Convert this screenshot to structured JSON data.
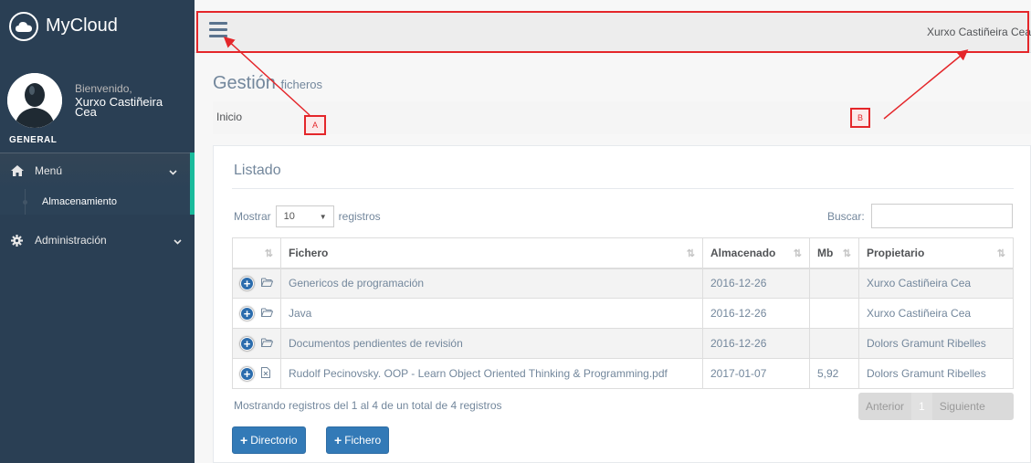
{
  "brand": {
    "title": "MyCloud"
  },
  "profile": {
    "welcome": "Bienvenido,",
    "name": "Xurxo Castiñeira Cea",
    "section": "GENERAL"
  },
  "sidebar": {
    "menu_label": "Menú",
    "submenu_item": "Almacenamiento",
    "admin_label": "Administración"
  },
  "topbar": {
    "user": "Xurxo Castiñeira Cea"
  },
  "page": {
    "title": "Gestión",
    "subtitle": "ficheros",
    "breadcrumb": "Inicio"
  },
  "annotations": {
    "a": "A",
    "b": "B"
  },
  "panel": {
    "title": "Listado",
    "show_label": "Mostrar",
    "show_value": "10",
    "show_suffix": "registros",
    "search_label": "Buscar:",
    "columns": [
      "Fichero",
      "Almacenado",
      "Mb",
      "Propietario"
    ],
    "rows": [
      {
        "type": "folder",
        "name": "Genericos de programación",
        "date": "2016-12-26",
        "mb": "",
        "owner": "Xurxo Castiñeira Cea"
      },
      {
        "type": "folder",
        "name": "Java",
        "date": "2016-12-26",
        "mb": "",
        "owner": "Xurxo Castiñeira Cea"
      },
      {
        "type": "folder",
        "name": "Documentos pendientes de revisión",
        "date": "2016-12-26",
        "mb": "",
        "owner": "Dolors Gramunt Ribelles"
      },
      {
        "type": "file",
        "name": "Rudolf Pecinovsky. OOP - Learn Object Oriented Thinking & Programming.pdf",
        "date": "2017-01-07",
        "mb": "5,92",
        "owner": "Dolors Gramunt Ribelles"
      }
    ],
    "info": "Mostrando registros del 1 al 4 de un total de 4 registros",
    "pager": {
      "prev": "Anterior",
      "page": "1",
      "next": "Siguiente"
    },
    "buttons": {
      "directory": "Directorio",
      "file": "Fichero",
      "plus": "+"
    }
  },
  "colors": {
    "sidebar": "#2a3f54",
    "accent": "#1abb9c",
    "primary": "#337ab7",
    "annotation": "#e4262a"
  }
}
